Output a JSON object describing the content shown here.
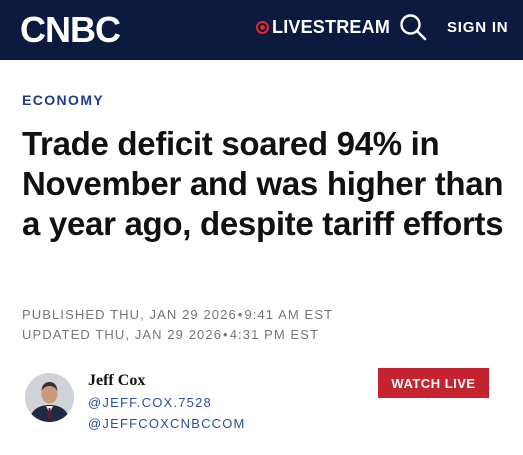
{
  "header": {
    "logo_text": "CNBC",
    "livestream_label": "LIVESTREAM",
    "signin_label": "SIGN IN",
    "background_color": "#0b1a3e",
    "live_color": "#e02b2b"
  },
  "article": {
    "section": "ECONOMY",
    "headline": "Trade deficit soared 94% in November and was higher than a year ago, despite tariff efforts",
    "published": {
      "label": "PUBLISHED THU, JAN 29 2026",
      "time": "9:41 AM EST"
    },
    "updated": {
      "label": "UPDATED THU, JAN 29 2026",
      "time": "4:31 PM EST"
    }
  },
  "author": {
    "name": "Jeff Cox",
    "handle_1": "@JEFF.COX.7528",
    "handle_2": "@JEFFCOXCNBCCOM"
  },
  "watch_live_label": "WATCH LIVE",
  "colors": {
    "section": "#1d3c8a",
    "handle": "#2a4fa3",
    "watch_live": "#c4232f"
  }
}
